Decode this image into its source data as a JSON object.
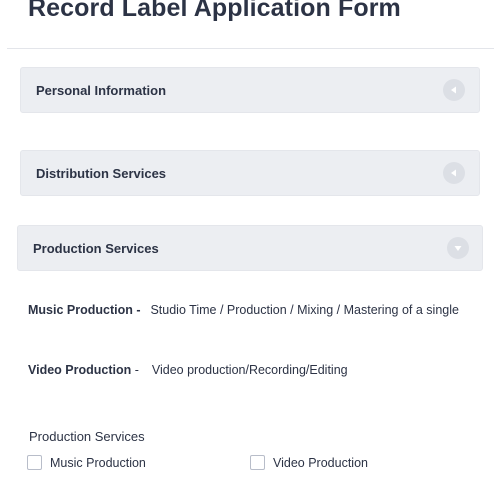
{
  "form": {
    "title": "Record Label Application Form"
  },
  "sections": [
    {
      "label": "Personal Information",
      "state": "collapsed",
      "icon": "triangle-left-icon"
    },
    {
      "label": "Distribution Services",
      "state": "collapsed",
      "icon": "triangle-left-icon"
    },
    {
      "label": "Production Services",
      "state": "expanded",
      "icon": "triangle-down-icon"
    }
  ],
  "production": {
    "descriptions": [
      {
        "term": "Music Production -",
        "detail": "Studio Time / Production / Mixing / Mastering of a single"
      },
      {
        "term": "Video Production",
        "separator": "-",
        "detail": "Video production/Recording/Editing"
      }
    ],
    "field_label": "Production Services",
    "options": [
      {
        "label": "Music Production",
        "checked": false
      },
      {
        "label": "Video Production",
        "checked": false
      }
    ]
  },
  "colors": {
    "text": "#2c3345",
    "section_bg": "#eceef2",
    "icon_bg": "#dcdfe5",
    "icon_glyph": "#ffffff",
    "divider": "#e3e5ea"
  }
}
